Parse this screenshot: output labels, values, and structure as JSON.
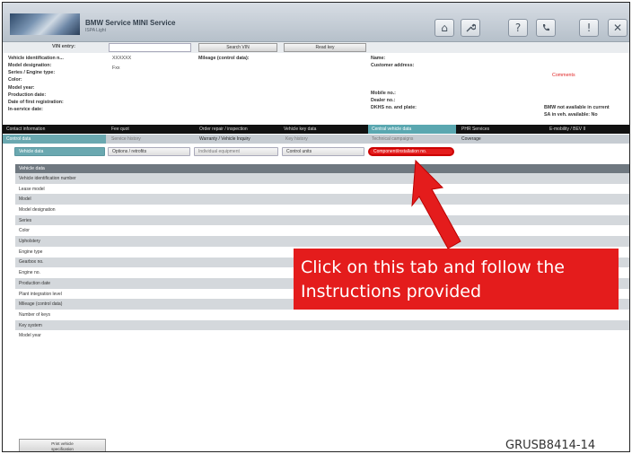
{
  "header": {
    "title": "BMW Service MINI Service",
    "subtitle": "ISPA Light",
    "buttons": [
      {
        "name": "home-icon",
        "glyph": "⌂"
      },
      {
        "name": "wrench-icon",
        "glyph": "🔧"
      },
      {
        "name": "help-icon",
        "glyph": "?"
      },
      {
        "name": "phone-icon",
        "glyph": "☎"
      },
      {
        "name": "alert-icon",
        "glyph": "!"
      },
      {
        "name": "close-icon",
        "glyph": "✕"
      }
    ]
  },
  "vin_row": {
    "label": "VIN entry:",
    "search_button": "Search VIN",
    "read_key_button": "Read key"
  },
  "info": {
    "left_labels": [
      "Vehicle identification n...",
      "Model designation:",
      "Series / Engine type:",
      "Color:",
      "Model year:",
      "Production date:",
      "Date of first registration:",
      "In-service date:"
    ],
    "vin_value": "XXXXXX",
    "series_value": "Fxx",
    "mileage_label": "Mileage (control data):",
    "customer_labels": [
      "Name:",
      "Customer address:"
    ],
    "contact_labels": [
      "Mobile no.:",
      "Dealer no.:",
      "DKHS no. and plate:"
    ],
    "comments": "Comments",
    "bmw_note_1": "BMW not available in current",
    "bmw_note_2": "SA in veh. available: No"
  },
  "tabs_row1": [
    "Contact information",
    "Fee quot",
    "Order repair / inspection",
    "Vehicle key data",
    "Central vehicle data",
    "PHR Services",
    "E-mobility / BEV II"
  ],
  "tabs_row2": [
    "Control data",
    "Service history",
    "Warranty / Vehicle Inquiry",
    "Key history",
    "Technical campaigns",
    "Coverage"
  ],
  "tabs_row3": [
    "Vehicle data",
    "Options / retrofits",
    "Individual equipment",
    "Control units",
    "Component/installation no."
  ],
  "content": {
    "header": "Vehicle data",
    "rows": [
      "Vehicle identification number",
      "Lease model",
      "Model",
      "Model designation",
      "Series",
      "Color",
      "Upholstery",
      "Engine type",
      "Gearbox no.",
      "Engine no.",
      "Production date",
      "Plant integration level",
      "Mileage (control data)",
      "Number of keys",
      "Key system",
      "Model year"
    ]
  },
  "annotation": {
    "line1": "Click on this tab and follow the",
    "line2": "Instructions provided",
    "color": "#e41c1c"
  },
  "footer": {
    "print_button_1": "Print vehicle",
    "print_button_2": "specification",
    "code": "GRUSB8414-14"
  }
}
